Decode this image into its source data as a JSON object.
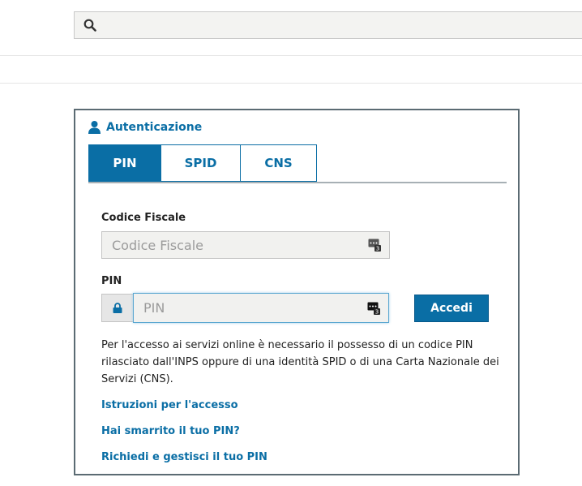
{
  "search": {
    "value": "",
    "placeholder": ""
  },
  "auth": {
    "title": "Autenticazione",
    "tabs": [
      {
        "label": "PIN",
        "active": true
      },
      {
        "label": "SPID",
        "active": false
      },
      {
        "label": "CNS",
        "active": false
      }
    ],
    "fiscal_code": {
      "label": "Codice Fiscale",
      "placeholder": "Codice Fiscale",
      "value": ""
    },
    "pin": {
      "label": "PIN",
      "placeholder": "PIN",
      "value": ""
    },
    "login_label": "Accedi",
    "info_text": "Per l'accesso ai servizi online è necessario il possesso di un codice PIN rilasciato dall'INPS oppure di una identità SPID o di una Carta Nazionale dei Servizi (CNS).",
    "links": [
      "Istruzioni per l'accesso",
      "Hai smarrito il tuo PIN?",
      "Richiedi e gestisci il tuo PIN"
    ]
  },
  "icons": {
    "search": "search-icon",
    "user": "user-icon",
    "keypad": "keypad-icon",
    "lock": "lock-icon"
  },
  "colors": {
    "accent": "#0a6ea5",
    "box_border": "#5b6b73",
    "input_bg": "#f1f1ef"
  }
}
